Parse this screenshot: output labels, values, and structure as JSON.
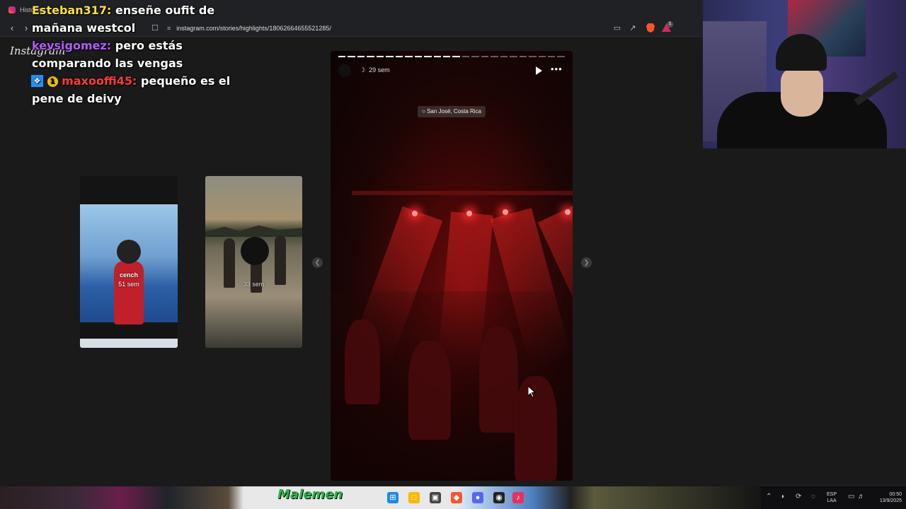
{
  "browser": {
    "tab_title": "Historias",
    "url": "instagram.com/stories/highlights/18062664655521285/",
    "back_icon": "back-arrow-icon",
    "forward_icon": "forward-arrow-icon",
    "alert_count": "1"
  },
  "instagram": {
    "logo": "Instagram",
    "previews": [
      {
        "name": "cench",
        "time": "51 sem"
      },
      {
        "name": "",
        "time": "33 sem"
      }
    ],
    "story": {
      "time": "29 sem",
      "location": "San José, Costa Rica",
      "progress_total": 24,
      "progress_done": 13
    }
  },
  "chat": [
    {
      "user": "Esteban317:",
      "text": "enseñe oufit de mañana westcol",
      "color": "#ffe23d"
    },
    {
      "user": "kevsigomez:",
      "text": "pero estás comparando las vengas",
      "color": "#b05cff"
    },
    {
      "user": "maxooffi45:",
      "text": "pequeño es el pene de deivy",
      "color": "#ff3b3b",
      "badges": [
        "sword",
        "gift"
      ]
    }
  ],
  "overlay_banner": "Malemen",
  "taskbar": {
    "language": "ESP",
    "language_sub": "LAA",
    "time": "00:50",
    "date": "13/9/2025"
  }
}
